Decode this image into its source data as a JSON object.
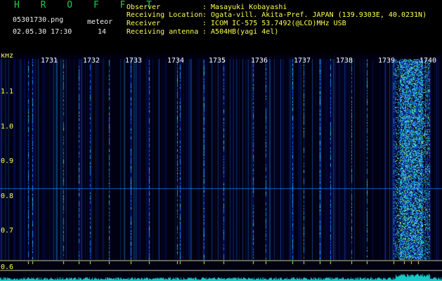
{
  "header": {
    "app_title": "H R O F F T",
    "filename": "05301730.png",
    "datetime": "02.05.30 17:30",
    "meteor_label": "meteor",
    "meteor_count": "14",
    "fields": [
      {
        "label": "Observer",
        "value": ": Masayuki Kobayashi"
      },
      {
        "label": "Receiving Location",
        "value": ": Ogata-vill. Akita-Pref. JAPAN (139.9303E, 40.0231N)"
      },
      {
        "label": "Receiver",
        "value": ": ICOM IC-575 53.7492(@LCD)MHz USB"
      },
      {
        "label": "Receiving antenna",
        "value": ": A504HB(yagi 4el)"
      }
    ]
  },
  "spectrogram": {
    "y_unit": "kHz",
    "y_ticks": [
      "1.1",
      "1.0",
      "0.9",
      "0.8",
      "0.7",
      "0.6"
    ],
    "time_ticks": [
      "1731",
      "1732",
      "1733",
      "1734",
      "1735",
      "1736",
      "1737",
      "1738",
      "1739",
      "1740"
    ],
    "colors": {
      "background": "#000010",
      "low": "#0a1aa0",
      "mid": "#1a8cff",
      "high": "#40e0c0",
      "peak": "#e0ff40",
      "tick_text": "#ffffff",
      "axis_text": "#ffff55",
      "baseline": "#c8c8a0",
      "level_trace": "#19c8c8"
    }
  }
}
